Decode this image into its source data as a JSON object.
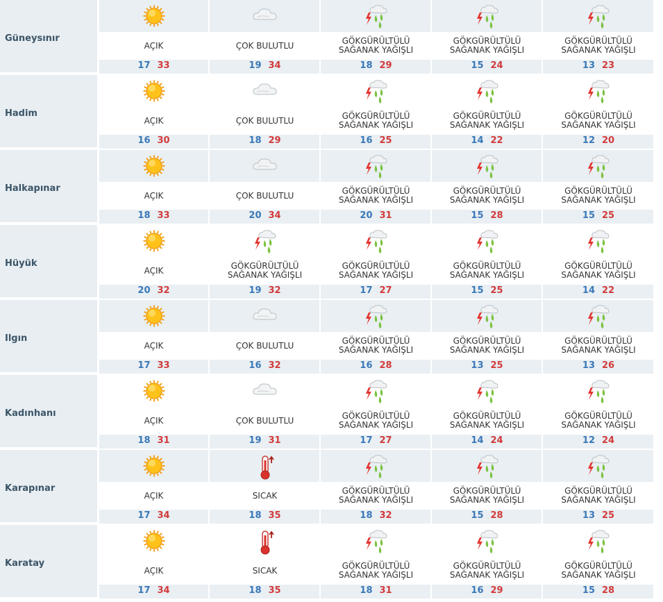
{
  "rows": [
    {
      "city": "Güneysınır",
      "days": [
        {
          "icon": "sun-icon",
          "cond": "AÇIK",
          "min": "17",
          "max": "33"
        },
        {
          "icon": "cloud-icon",
          "cond": "ÇOK BULUTLU",
          "min": "19",
          "max": "34"
        },
        {
          "icon": "thunderstorm-icon",
          "cond": "GÖKGÜRÜLTÜLÜ SAĞANAK YAĞIŞLI",
          "min": "18",
          "max": "29"
        },
        {
          "icon": "thunderstorm-icon",
          "cond": "GÖKGÜRÜLTÜLÜ SAĞANAK YAĞIŞLI",
          "min": "15",
          "max": "24"
        },
        {
          "icon": "thunderstorm-icon",
          "cond": "GÖKGÜRÜLTÜLÜ SAĞANAK YAĞIŞLI",
          "min": "13",
          "max": "23"
        }
      ]
    },
    {
      "city": "Hadim",
      "days": [
        {
          "icon": "sun-icon",
          "cond": "AÇIK",
          "min": "16",
          "max": "30"
        },
        {
          "icon": "cloud-icon",
          "cond": "ÇOK BULUTLU",
          "min": "18",
          "max": "29"
        },
        {
          "icon": "thunderstorm-icon",
          "cond": "GÖKGÜRÜLTÜLÜ SAĞANAK YAĞIŞLI",
          "min": "16",
          "max": "25"
        },
        {
          "icon": "thunderstorm-icon",
          "cond": "GÖKGÜRÜLTÜLÜ SAĞANAK YAĞIŞLI",
          "min": "14",
          "max": "22"
        },
        {
          "icon": "thunderstorm-icon",
          "cond": "GÖKGÜRÜLTÜLÜ SAĞANAK YAĞIŞLI",
          "min": "12",
          "max": "20"
        }
      ]
    },
    {
      "city": "Halkapınar",
      "days": [
        {
          "icon": "sun-icon",
          "cond": "AÇIK",
          "min": "18",
          "max": "33"
        },
        {
          "icon": "cloud-icon",
          "cond": "ÇOK BULUTLU",
          "min": "20",
          "max": "34"
        },
        {
          "icon": "thunderstorm-icon",
          "cond": "GÖKGÜRÜLTÜLÜ SAĞANAK YAĞIŞLI",
          "min": "20",
          "max": "31"
        },
        {
          "icon": "thunderstorm-icon",
          "cond": "GÖKGÜRÜLTÜLÜ SAĞANAK YAĞIŞLI",
          "min": "15",
          "max": "28"
        },
        {
          "icon": "thunderstorm-icon",
          "cond": "GÖKGÜRÜLTÜLÜ SAĞANAK YAĞIŞLI",
          "min": "15",
          "max": "25"
        }
      ]
    },
    {
      "city": "Hüyük",
      "days": [
        {
          "icon": "sun-icon",
          "cond": "AÇIK",
          "min": "20",
          "max": "32"
        },
        {
          "icon": "thunderstorm-icon",
          "cond": "GÖKGÜRÜLTÜLÜ SAĞANAK YAĞIŞLI",
          "min": "19",
          "max": "32"
        },
        {
          "icon": "thunderstorm-icon",
          "cond": "GÖKGÜRÜLTÜLÜ SAĞANAK YAĞIŞLI",
          "min": "17",
          "max": "27"
        },
        {
          "icon": "thunderstorm-icon",
          "cond": "GÖKGÜRÜLTÜLÜ SAĞANAK YAĞIŞLI",
          "min": "15",
          "max": "25"
        },
        {
          "icon": "thunderstorm-icon",
          "cond": "GÖKGÜRÜLTÜLÜ SAĞANAK YAĞIŞLI",
          "min": "14",
          "max": "22"
        }
      ]
    },
    {
      "city": "Ilgın",
      "days": [
        {
          "icon": "sun-icon",
          "cond": "AÇIK",
          "min": "17",
          "max": "33"
        },
        {
          "icon": "cloud-icon",
          "cond": "ÇOK BULUTLU",
          "min": "16",
          "max": "32"
        },
        {
          "icon": "thunderstorm-icon",
          "cond": "GÖKGÜRÜLTÜLÜ SAĞANAK YAĞIŞLI",
          "min": "16",
          "max": "28"
        },
        {
          "icon": "thunderstorm-icon",
          "cond": "GÖKGÜRÜLTÜLÜ SAĞANAK YAĞIŞLI",
          "min": "13",
          "max": "25"
        },
        {
          "icon": "thunderstorm-icon",
          "cond": "GÖKGÜRÜLTÜLÜ SAĞANAK YAĞIŞLI",
          "min": "13",
          "max": "26"
        }
      ]
    },
    {
      "city": "Kadınhanı",
      "days": [
        {
          "icon": "sun-icon",
          "cond": "AÇIK",
          "min": "18",
          "max": "31"
        },
        {
          "icon": "cloud-icon",
          "cond": "ÇOK BULUTLU",
          "min": "19",
          "max": "31"
        },
        {
          "icon": "thunderstorm-icon",
          "cond": "GÖKGÜRÜLTÜLÜ SAĞANAK YAĞIŞLI",
          "min": "17",
          "max": "27"
        },
        {
          "icon": "thunderstorm-icon",
          "cond": "GÖKGÜRÜLTÜLÜ SAĞANAK YAĞIŞLI",
          "min": "14",
          "max": "24"
        },
        {
          "icon": "thunderstorm-icon",
          "cond": "GÖKGÜRÜLTÜLÜ SAĞANAK YAĞIŞLI",
          "min": "12",
          "max": "24"
        }
      ]
    },
    {
      "city": "Karapınar",
      "days": [
        {
          "icon": "sun-icon",
          "cond": "AÇIK",
          "min": "17",
          "max": "34"
        },
        {
          "icon": "thermometer-icon",
          "cond": "SICAK",
          "min": "18",
          "max": "35"
        },
        {
          "icon": "thunderstorm-icon",
          "cond": "GÖKGÜRÜLTÜLÜ SAĞANAK YAĞIŞLI",
          "min": "18",
          "max": "32"
        },
        {
          "icon": "thunderstorm-icon",
          "cond": "GÖKGÜRÜLTÜLÜ SAĞANAK YAĞIŞLI",
          "min": "15",
          "max": "28"
        },
        {
          "icon": "thunderstorm-icon",
          "cond": "GÖKGÜRÜLTÜLÜ SAĞANAK YAĞIŞLI",
          "min": "13",
          "max": "25"
        }
      ]
    },
    {
      "city": "Karatay",
      "days": [
        {
          "icon": "sun-icon",
          "cond": "AÇIK",
          "min": "17",
          "max": "34"
        },
        {
          "icon": "thermometer-icon",
          "cond": "SICAK",
          "min": "18",
          "max": "35"
        },
        {
          "icon": "thunderstorm-icon",
          "cond": "GÖKGÜRÜLTÜLÜ SAĞANAK YAĞIŞLI",
          "min": "18",
          "max": "31"
        },
        {
          "icon": "thunderstorm-icon",
          "cond": "GÖKGÜRÜLTÜLÜ SAĞANAK YAĞIŞLI",
          "min": "16",
          "max": "29"
        },
        {
          "icon": "thunderstorm-icon",
          "cond": "GÖKGÜRÜLTÜLÜ SAĞANAK YAĞIŞLI",
          "min": "15",
          "max": "28"
        }
      ]
    }
  ],
  "colors": {
    "min_temp": "#3a78b8",
    "max_temp": "#d23a3a",
    "band": "#e9eff3",
    "city_text": "#3c5568"
  }
}
